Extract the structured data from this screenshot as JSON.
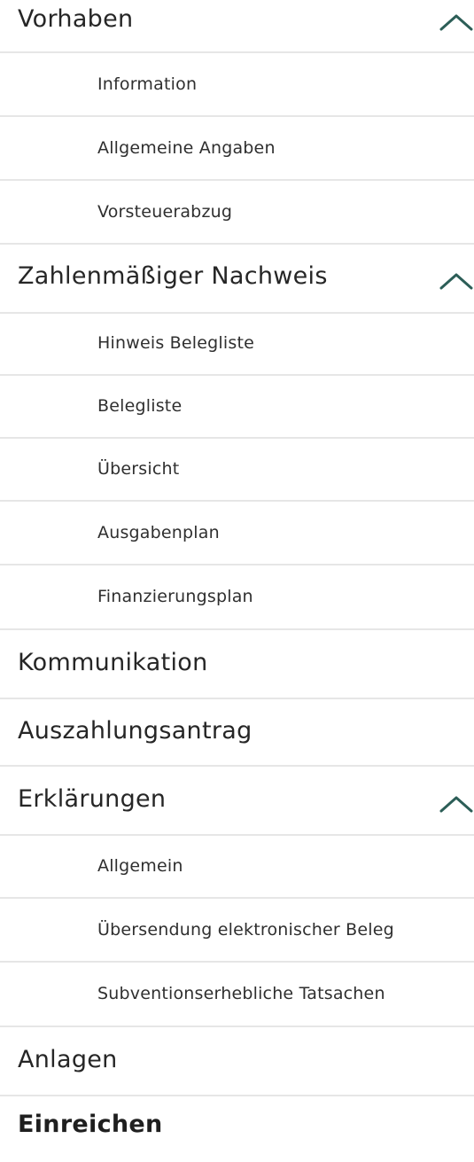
{
  "colors": {
    "chevron": "#2c5e57",
    "divider": "#e6e6e6",
    "text": "#262626"
  },
  "nav": {
    "vorhaben": {
      "label": "Vorhaben",
      "expanded": true,
      "icon": "chevron-up-icon",
      "items": [
        "Information",
        "Allgemeine Angaben",
        "Vorsteuerabzug"
      ]
    },
    "nachweis": {
      "label": "Zahlenmäßiger Nachweis",
      "expanded": true,
      "icon": "chevron-up-icon",
      "items": [
        "Hinweis Belegliste",
        "Belegliste",
        "Übersicht",
        "Ausgabenplan",
        "Finanzierungsplan"
      ]
    },
    "kommunikation": {
      "label": "Kommunikation"
    },
    "auszahlungsantrag": {
      "label": "Auszahlungsantrag"
    },
    "erklaerungen": {
      "label": "Erklärungen",
      "expanded": true,
      "icon": "chevron-up-icon",
      "items": [
        "Allgemein",
        "Übersendung elektronischer Beleg",
        "Subventionserhebliche Tatsachen"
      ]
    },
    "anlagen": {
      "label": "Anlagen"
    },
    "einreichen": {
      "label": "Einreichen"
    }
  }
}
